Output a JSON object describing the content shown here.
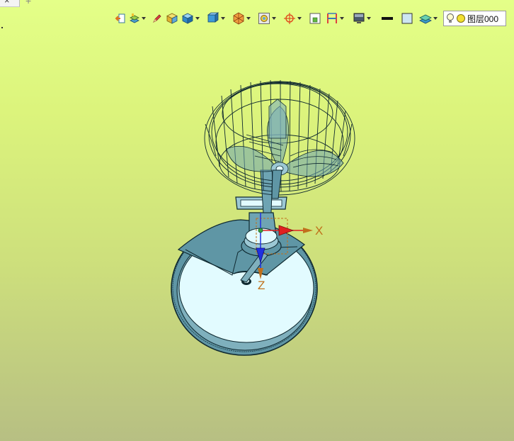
{
  "tabs": {
    "active_close_glyph": "×",
    "add_glyph": "+"
  },
  "toolbar": {
    "layer_label": "图层000"
  },
  "viewport": {
    "axis_x_label": "X",
    "axis_z_label": "Z"
  },
  "colors": {
    "bg_top": "#e4ff88",
    "bg_bottom": "#b7bf83",
    "base_fill": "#e2fbff",
    "model_fill": "#7fb0bd",
    "wire": "#0f2930",
    "axis_x": "#e02020",
    "axis_z": "#2030e0",
    "axis_label": "#c0701b"
  }
}
